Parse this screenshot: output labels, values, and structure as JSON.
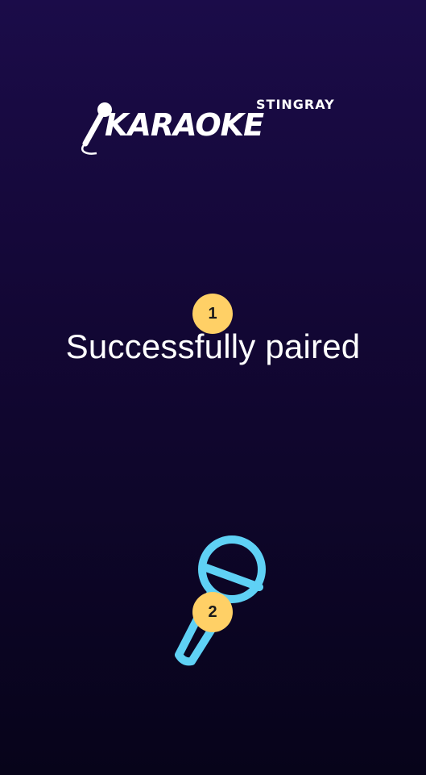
{
  "logo": {
    "brand": "STINGRAY",
    "product": "KARAOKE"
  },
  "status": {
    "message": "Successfully paired"
  },
  "badges": [
    {
      "label": "1"
    },
    {
      "label": "2"
    }
  ],
  "icons": {
    "logo_mic": "microphone-icon",
    "main_mic": "microphone-icon"
  },
  "colors": {
    "background_top": "#1b0c49",
    "background_bottom": "#07041a",
    "mic_accent": "#5fd1f5",
    "badge": "#ffd066"
  }
}
